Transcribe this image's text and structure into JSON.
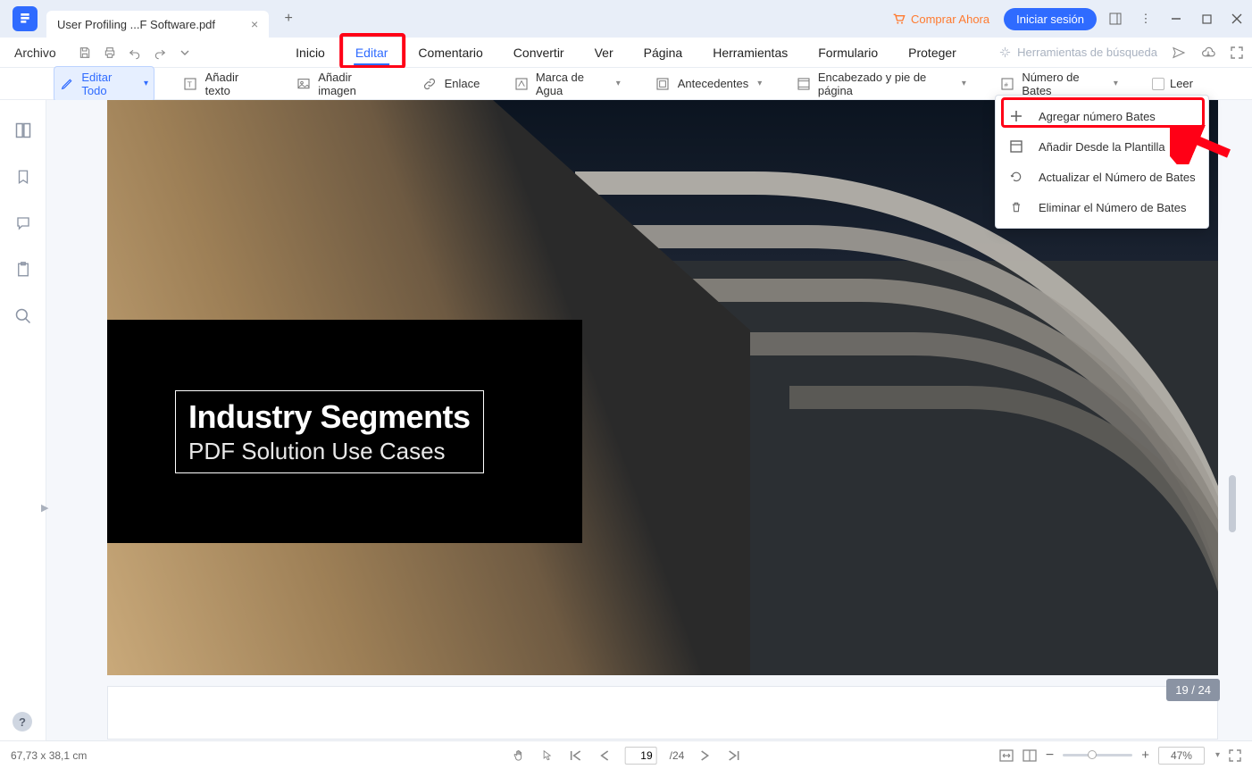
{
  "titlebar": {
    "tab_title": "User Profiling ...F Software.pdf",
    "buy": "Comprar Ahora",
    "signin": "Iniciar sesión"
  },
  "menubar": {
    "file": "Archivo",
    "items": [
      "Inicio",
      "Editar",
      "Comentario",
      "Convertir",
      "Ver",
      "Página",
      "Herramientas",
      "Formulario",
      "Proteger"
    ],
    "search": "Herramientas de búsqueda"
  },
  "toolbar": {
    "edit_all": "Editar Todo",
    "add_text": "Añadir texto",
    "add_image": "Añadir imagen",
    "link": "Enlace",
    "watermark": "Marca de Agua",
    "background": "Antecedentes",
    "header_footer": "Encabezado y pie de página",
    "bates": "Número de Bates",
    "read": "Leer"
  },
  "dropdown": {
    "add": "Agregar número Bates",
    "template": "Añadir Desde la Plantilla",
    "update": "Actualizar el Número de Bates",
    "delete": "Eliminar el Número de Bates"
  },
  "doc": {
    "title": "Industry Segments",
    "subtitle": "PDF Solution Use Cases",
    "badge": "19 / 24"
  },
  "status": {
    "coords": "67,73 x 38,1 cm",
    "page_current": "19",
    "page_total": "/24",
    "zoom": "47%"
  }
}
